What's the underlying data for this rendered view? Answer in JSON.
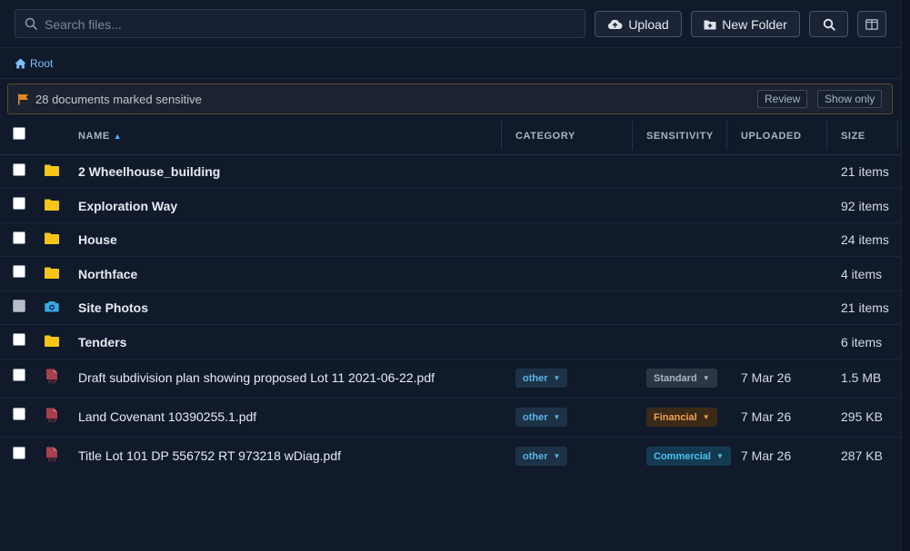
{
  "toolbar": {
    "search_placeholder": "Search files...",
    "upload_label": "Upload",
    "new_folder_label": "New Folder"
  },
  "breadcrumb": {
    "root_label": "Root"
  },
  "banner": {
    "text": "28 documents marked sensitive",
    "review_label": "Review",
    "show_only_label": "Show only"
  },
  "table": {
    "columns": {
      "name": "NAME",
      "category": "CATEGORY",
      "sensitivity": "SENSITIVITY",
      "uploaded": "UPLOADED",
      "size": "SIZE"
    },
    "folders": [
      {
        "name": "2 Wheelhouse_building",
        "size": "21 items",
        "icon": "folder-icon"
      },
      {
        "name": "Exploration Way",
        "size": "92 items",
        "icon": "folder-icon"
      },
      {
        "name": "House",
        "size": "24 items",
        "icon": "folder-icon"
      },
      {
        "name": "Northface",
        "size": "4 items",
        "icon": "folder-icon"
      },
      {
        "name": "Site Photos",
        "size": "21 items",
        "icon": "camera-folder-icon"
      },
      {
        "name": "Tenders",
        "size": "6 items",
        "icon": "folder-icon"
      }
    ],
    "files": [
      {
        "name": "Draft subdivision plan showing proposed Lot 11 2021-06-22.pdf",
        "category": "other",
        "sensitivity": "Standard",
        "uploaded": "7 Mar 26",
        "size": "1.5 MB",
        "icon": "pdf-icon"
      },
      {
        "name": "Land Covenant 10390255.1.pdf",
        "category": "other",
        "sensitivity": "Financial",
        "uploaded": "7 Mar 26",
        "size": "295 KB",
        "icon": "pdf-icon"
      },
      {
        "name": "Title Lot 101 DP 556752 RT 973218 wDiag.pdf",
        "category": "other",
        "sensitivity": "Commercial",
        "uploaded": "7 Mar 26",
        "size": "287 KB",
        "icon": "pdf-icon"
      }
    ]
  },
  "colors": {
    "background": "#101a2b",
    "folder": "#f5c518",
    "accent": "#4fa8ff",
    "warning": "#e08a1e"
  }
}
